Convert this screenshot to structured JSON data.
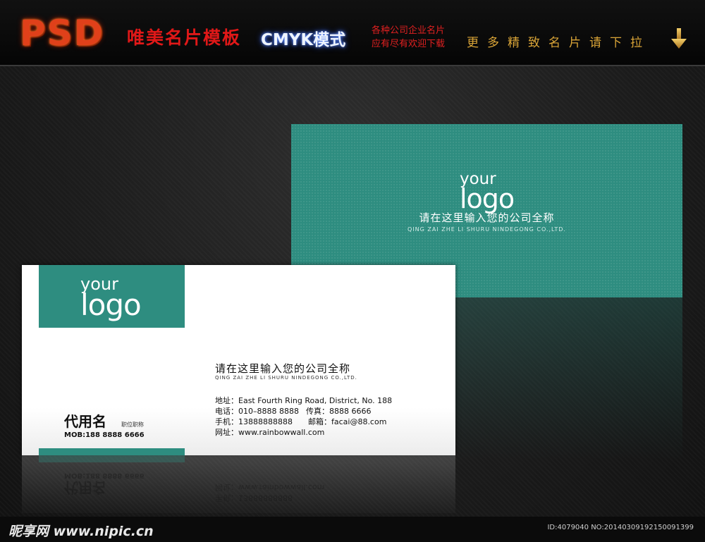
{
  "header": {
    "psd_badge": "PSD",
    "title": "唯美名片模板",
    "mode": "CMYK模式",
    "tagline_line1": "各种公司企业名片",
    "tagline_line2": "应有尽有欢迎下载",
    "more_text": "更多精致名片请下拉",
    "arrow_icon": "down-arrow-icon"
  },
  "back_card": {
    "logo_line1": "your",
    "logo_line2": "logo",
    "company_cn": "请在这里输入您的公司全称",
    "company_en": "QING ZAI ZHE LI SHURU NINDEGONG CO.,LTD."
  },
  "front_card": {
    "logo_line1": "your",
    "logo_line2": "logo",
    "company_cn": "请在这里输入您的公司全称",
    "company_en": "QING ZAI ZHE LI SHURU NINDEGONG CO.,LTD.",
    "name": "代用名",
    "position": "职位职称",
    "mob": "MOB:188 8888 6666",
    "address": "地址：East Fourth Ring Road, District, No. 188",
    "phone": "电话：010–8888 8888",
    "fax": "传真：8888 6666",
    "mobile": "手机：13888888888",
    "email": "邮箱：facai@88.com",
    "website": "网址：www.rainbowwall.com"
  },
  "colors": {
    "teal": "#2e8d80",
    "header_red": "#e01818",
    "gold": "#d9a437"
  },
  "footer": {
    "watermark": "昵享网 www.nipic.cn",
    "id_text": "ID:4079040 NO:20140309192150091399"
  }
}
